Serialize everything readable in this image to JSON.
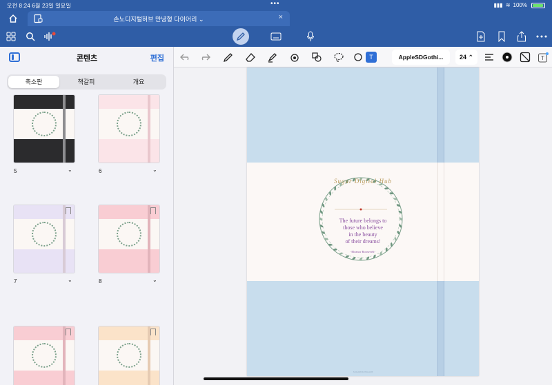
{
  "status": {
    "time_date": "오전 8:24   6월 23일 일요일",
    "battery_text": "100%",
    "dots": "•••"
  },
  "tab": {
    "title": "손노디지털허브 만녕형 다이어리  ⌄",
    "close": "×"
  },
  "sidebar": {
    "title": "콘텐츠",
    "edit_label": "편집",
    "segments": [
      "축소판",
      "책갈피",
      "개요"
    ],
    "thumbnails": [
      {
        "page": "5",
        "top_color": "#2b2b2d",
        "bottom_color": "#2b2b2d",
        "strap_color": "#8d8d90"
      },
      {
        "page": "6",
        "top_color": "#fbe4e8",
        "bottom_color": "#fbe4e8",
        "strap_color": "#e9c7cd"
      },
      {
        "page": "7",
        "top_color": "#e8e2f5",
        "bottom_color": "#e8e2f5",
        "strap_color": "#d8cbd6"
      },
      {
        "page": "8",
        "top_color": "#f9cdd3",
        "bottom_color": "#f9cdd3",
        "strap_color": "#e2b4bb"
      },
      {
        "page": "",
        "top_color": "#f9cdd3",
        "bottom_color": "#f9cdd3",
        "strap_color": "#e2b4bb"
      },
      {
        "page": "",
        "top_color": "#fbe3c9",
        "bottom_color": "#fbe3c9",
        "strap_color": "#e6cbb3"
      }
    ],
    "chevron": "⌄"
  },
  "editbar": {
    "font_name": "AppleSDGothi...",
    "font_size": "24 ⌃",
    "text_tool": "T"
  },
  "page": {
    "brand": "Sugar Digital Hub",
    "quote_lines": [
      "The future belongs to",
      "those who believe",
      "in the beauty",
      "of their dreams!"
    ],
    "author": "-Eleanor Roosevelt-",
    "footer": "SUGARDIGITALHUB"
  },
  "colors": {
    "accent_blue": "#2f5da6",
    "page_blue": "#c8dded",
    "quote_purple": "#8a4fa0"
  }
}
